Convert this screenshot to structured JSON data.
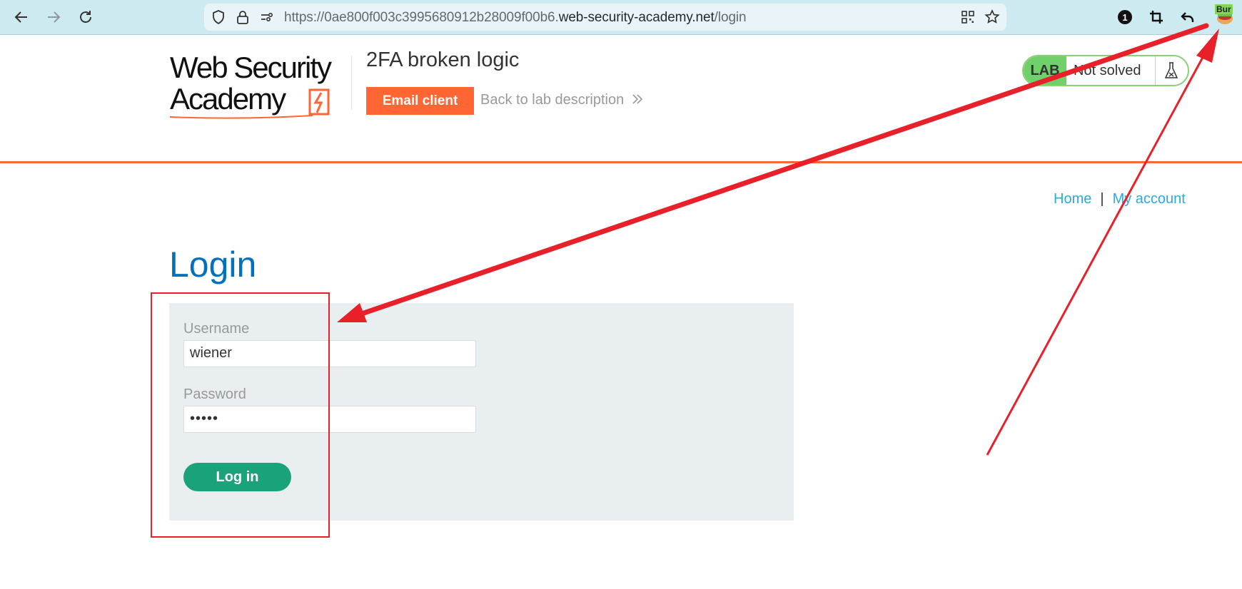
{
  "browser": {
    "url_prefix": "https://0ae800f003c3995680912b28009f00b6.",
    "url_domain": "web-security-academy.net",
    "url_path": "/login",
    "extension_label": "Bur"
  },
  "header": {
    "logo_line1": "Web Security",
    "logo_line2": "Academy",
    "lab_title": "2FA broken logic",
    "email_client_label": "Email client",
    "back_link_label": "Back to lab description",
    "lab_badge": "LAB",
    "lab_status": "Not solved"
  },
  "nav": {
    "home": "Home",
    "separator": "|",
    "my_account": "My account"
  },
  "main": {
    "title": "Login",
    "username_label": "Username",
    "username_value": "wiener",
    "password_label": "Password",
    "password_value": "•••••",
    "login_button": "Log in"
  },
  "colors": {
    "accent_orange": "#ff6633",
    "link_blue": "#29abe2",
    "title_blue": "#0071bc",
    "button_green": "#1aa37a",
    "annotation_red": "#e8202a"
  }
}
